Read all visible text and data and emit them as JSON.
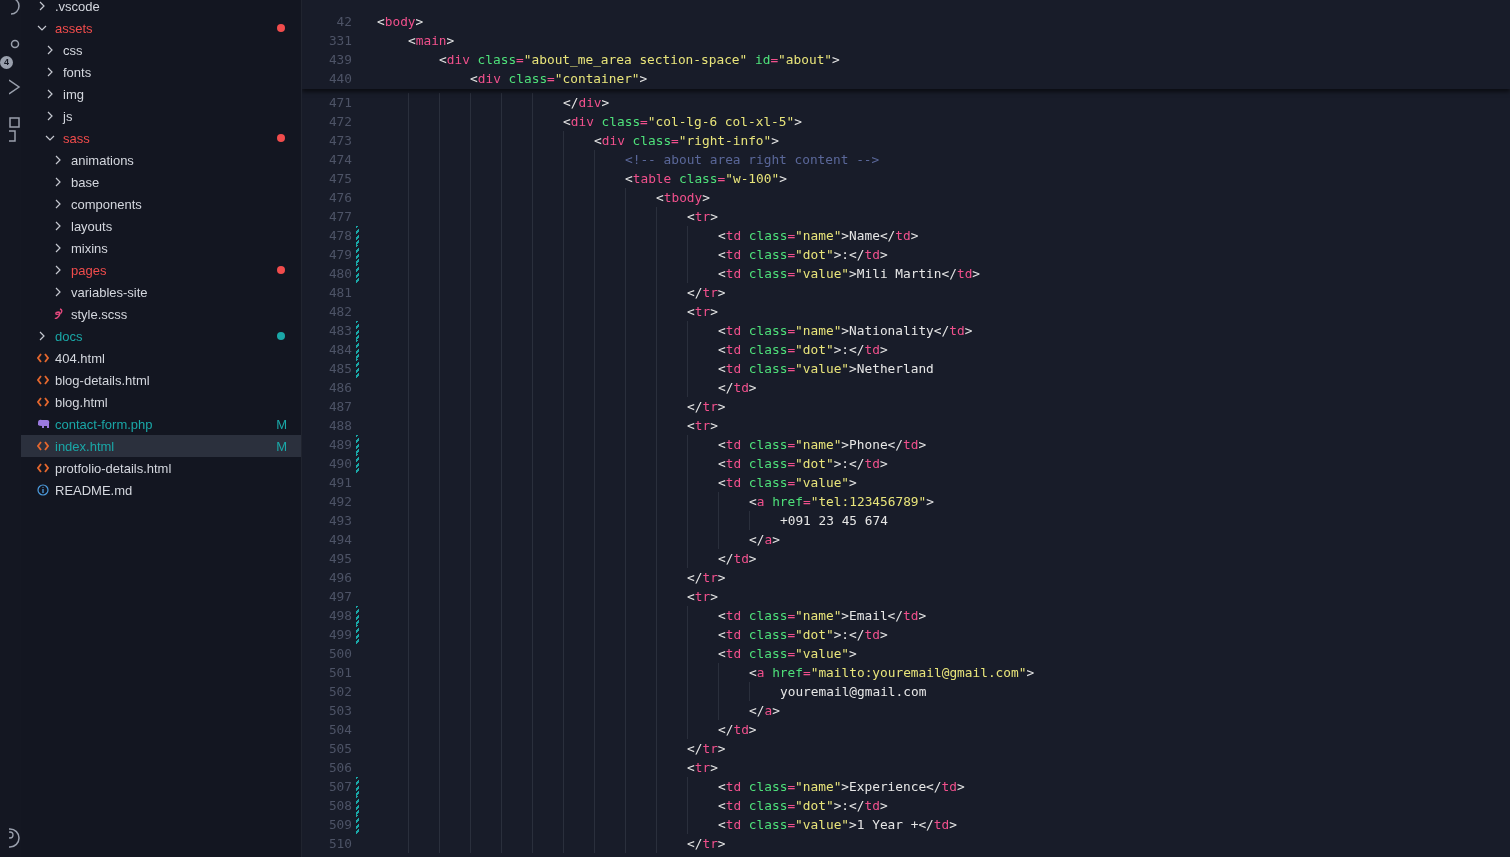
{
  "activity_bar": {
    "badge": "4"
  },
  "explorer": {
    "items": [
      {
        "name": ".vscode",
        "kind": "folder",
        "expanded": false,
        "selected": false
      },
      {
        "name": "assets",
        "kind": "folder",
        "expanded": true,
        "selected": false,
        "color": "#f14c4c",
        "children": [
          {
            "name": "css",
            "kind": "folder",
            "expanded": false,
            "selected": false
          },
          {
            "name": "fonts",
            "kind": "folder",
            "expanded": false,
            "selected": false
          },
          {
            "name": "img",
            "kind": "folder",
            "expanded": false,
            "selected": false
          },
          {
            "name": "js",
            "kind": "folder",
            "expanded": false,
            "selected": false
          },
          {
            "name": "sass",
            "kind": "folder",
            "expanded": true,
            "selected": false,
            "color": "#f14c4c",
            "children": [
              {
                "name": "animations",
                "kind": "folder",
                "expanded": false,
                "selected": false
              },
              {
                "name": "base",
                "kind": "folder",
                "expanded": false,
                "selected": false
              },
              {
                "name": "components",
                "kind": "folder",
                "expanded": false,
                "selected": false
              },
              {
                "name": "layouts",
                "kind": "folder",
                "expanded": false,
                "selected": false
              },
              {
                "name": "mixins",
                "kind": "folder",
                "expanded": false,
                "selected": false
              },
              {
                "name": "pages",
                "kind": "folder",
                "expanded": false,
                "selected": false,
                "color": "#f14c4c"
              },
              {
                "name": "variables-site",
                "kind": "folder",
                "expanded": false,
                "selected": false
              },
              {
                "name": "style.scss",
                "kind": "sass",
                "selected": false
              }
            ]
          }
        ]
      },
      {
        "name": "docs",
        "kind": "folder",
        "expanded": false,
        "selected": false,
        "color": "#1aa7a7"
      },
      {
        "name": "404.html",
        "kind": "html",
        "selected": false
      },
      {
        "name": "blog-details.html",
        "kind": "html",
        "selected": false
      },
      {
        "name": "blog.html",
        "kind": "html",
        "selected": false
      },
      {
        "name": "contact-form.php",
        "kind": "php",
        "selected": false,
        "color": "#1aa7a7",
        "badge": "M"
      },
      {
        "name": "index.html",
        "kind": "html",
        "selected": true,
        "color": "#1aa7a7",
        "badge": "M"
      },
      {
        "name": "protfolio-details.html",
        "kind": "html",
        "selected": false
      },
      {
        "name": "README.md",
        "kind": "info",
        "selected": false
      }
    ]
  },
  "editor": {
    "sticky_lines": [
      {
        "number": "42",
        "text": "<body>"
      },
      {
        "number": "331",
        "text": "    <main>"
      },
      {
        "number": "439",
        "text": "        <div class=\"about_me_area section-space\" id=\"about\">"
      },
      {
        "number": "440",
        "text": "            <div class=\"container\">"
      }
    ],
    "lines": [
      {
        "number": "471",
        "text": "                        </div>"
      },
      {
        "number": "472",
        "text": "                        <div class=\"col-lg-6 col-xl-5\">"
      },
      {
        "number": "473",
        "text": "                            <div class=\"right-info\">"
      },
      {
        "number": "474",
        "text": "                                <!-- about area right content -->"
      },
      {
        "number": "475",
        "text": "                                <table class=\"w-100\">"
      },
      {
        "number": "476",
        "text": "                                    <tbody>"
      },
      {
        "number": "477",
        "text": "                                        <tr>"
      },
      {
        "number": "478",
        "text": "                                            <td class=\"name\">Name</td>",
        "changed": true
      },
      {
        "number": "479",
        "text": "                                            <td class=\"dot\">:</td>",
        "changed": true
      },
      {
        "number": "480",
        "text": "                                            <td class=\"value\">Mili Martin</td>",
        "changed": true
      },
      {
        "number": "481",
        "text": "                                        </tr>"
      },
      {
        "number": "482",
        "text": "                                        <tr>"
      },
      {
        "number": "483",
        "text": "                                            <td class=\"name\">Nationality</td>",
        "changed": true
      },
      {
        "number": "484",
        "text": "                                            <td class=\"dot\">:</td>",
        "changed": true
      },
      {
        "number": "485",
        "text": "                                            <td class=\"value\">Netherland",
        "changed": true
      },
      {
        "number": "486",
        "text": "                                            </td>"
      },
      {
        "number": "487",
        "text": "                                        </tr>"
      },
      {
        "number": "488",
        "text": "                                        <tr>"
      },
      {
        "number": "489",
        "text": "                                            <td class=\"name\">Phone</td>",
        "changed": true
      },
      {
        "number": "490",
        "text": "                                            <td class=\"dot\">:</td>",
        "changed": true
      },
      {
        "number": "491",
        "text": "                                            <td class=\"value\">"
      },
      {
        "number": "492",
        "text": "                                                <a href=\"tel:123456789\">"
      },
      {
        "number": "493",
        "text": "                                                    +091 23 45 674"
      },
      {
        "number": "494",
        "text": "                                                </a>"
      },
      {
        "number": "495",
        "text": "                                            </td>"
      },
      {
        "number": "496",
        "text": "                                        </tr>"
      },
      {
        "number": "497",
        "text": "                                        <tr>"
      },
      {
        "number": "498",
        "text": "                                            <td class=\"name\">Email</td>",
        "changed": true
      },
      {
        "number": "499",
        "text": "                                            <td class=\"dot\">:</td>",
        "changed": true
      },
      {
        "number": "500",
        "text": "                                            <td class=\"value\">"
      },
      {
        "number": "501",
        "text": "                                                <a href=\"mailto:youremail@gmail.com\">"
      },
      {
        "number": "502",
        "text": "                                                    youremail@gmail.com"
      },
      {
        "number": "503",
        "text": "                                                </a>"
      },
      {
        "number": "504",
        "text": "                                            </td>"
      },
      {
        "number": "505",
        "text": "                                        </tr>"
      },
      {
        "number": "506",
        "text": "                                        <tr>"
      },
      {
        "number": "507",
        "text": "                                            <td class=\"name\">Experience</td>",
        "changed": true
      },
      {
        "number": "508",
        "text": "                                            <td class=\"dot\">:</td>",
        "changed": true
      },
      {
        "number": "509",
        "text": "                                            <td class=\"value\">1 Year +</td>",
        "changed": true
      },
      {
        "number": "510",
        "text": "                                        </tr>"
      }
    ]
  }
}
